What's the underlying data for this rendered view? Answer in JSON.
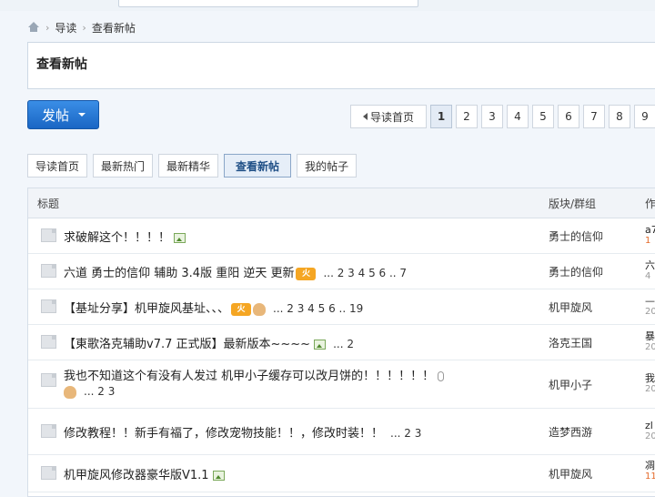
{
  "breadcrumb": {
    "items": [
      "导读",
      "查看新帖"
    ]
  },
  "page_title": "查看新帖",
  "post_button": "发帖",
  "pager": {
    "first": "导读首页",
    "pages": [
      "1",
      "2",
      "3",
      "4",
      "5",
      "6",
      "7",
      "8",
      "9"
    ],
    "current": "1"
  },
  "tabs": [
    "导读首页",
    "最新热门",
    "最新精华",
    "查看新帖",
    "我的帖子"
  ],
  "active_tab": "查看新帖",
  "table": {
    "headers": {
      "title": "标题",
      "forum": "版块/群组",
      "author": "作"
    },
    "rows": [
      {
        "title": "求破解这个！！！！",
        "pages": "",
        "forum": "勇士的信仰",
        "author": "a7",
        "date": "1",
        "date_hot": true
      },
      {
        "title": "六道 勇士的信仰 辅助 3.4版 重阳 逆天 更新",
        "pages": "... 2 3 4 5 6 .. 7",
        "forum": "勇士的信仰",
        "author": "六",
        "date": "4",
        "date_hot": false
      },
      {
        "title": "【基址分享】机甲旋风基址、、、",
        "pages": "... 2 3 4 5 6 .. 19",
        "forum": "机甲旋风",
        "author": "—",
        "date": "20",
        "date_hot": false
      },
      {
        "title": "【東歌洛克辅助v7.7 正式版】最新版本~~~~",
        "pages": "... 2",
        "forum": "洛克王国",
        "author": "暴",
        "date": "20",
        "date_hot": false
      },
      {
        "title": "我也不知道这个有没有人发过 机甲小子缓存可以改月饼的！！！！！！",
        "pages": "... 2 3",
        "forum": "机甲小子",
        "author": "我",
        "date": "20",
        "date_hot": false
      },
      {
        "title": "修改教程！！新手有福了，修改宠物技能！！，修改时装！！",
        "pages": "... 2 3",
        "forum": "造梦西游",
        "author": "zl",
        "date": "20",
        "date_hot": false
      },
      {
        "title": "机甲旋风修改器豪华版V1.1",
        "pages": "",
        "forum": "机甲旋风",
        "author": "凋",
        "date": "11",
        "date_hot": true
      }
    ]
  },
  "icons": {
    "hot_badge": "火",
    "colors": {
      "accent": "#1a66c4",
      "hot": "#f5a623"
    }
  }
}
